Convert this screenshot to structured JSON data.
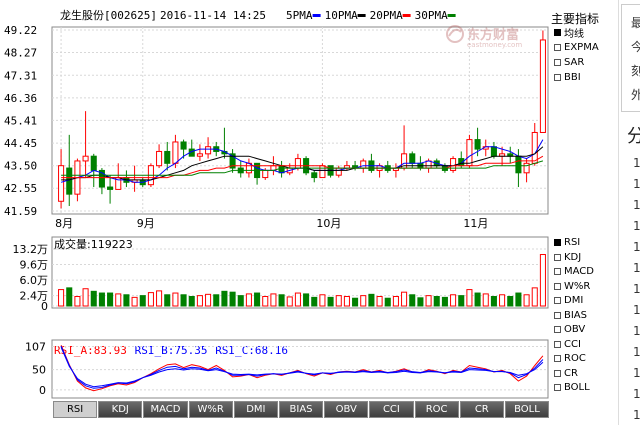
{
  "header": {
    "stock": "龙生股份[002625]",
    "datetime": "2016-11-14 14:25",
    "ma_legend": [
      {
        "label": "5PMA",
        "color": "#0000ff"
      },
      {
        "label": "10PMA",
        "color": "#000000"
      },
      {
        "label": "20PMA",
        "color": "#ff0000"
      },
      {
        "label": "30PMA",
        "color": "#008000"
      }
    ]
  },
  "logo": {
    "text": "东方财富",
    "sub": "eastmoney.com"
  },
  "side_main": {
    "title": "主要指标",
    "items": [
      {
        "label": "均线",
        "on": true
      },
      {
        "label": "EXPMA",
        "on": false
      },
      {
        "label": "SAR",
        "on": false
      },
      {
        "label": "BBI",
        "on": false
      }
    ]
  },
  "side_sub": {
    "items": [
      {
        "label": "RSI",
        "on": true
      },
      {
        "label": "KDJ",
        "on": false
      },
      {
        "label": "MACD",
        "on": false
      },
      {
        "label": "W%R",
        "on": false
      },
      {
        "label": "DMI",
        "on": false
      },
      {
        "label": "BIAS",
        "on": false
      },
      {
        "label": "OBV",
        "on": false
      },
      {
        "label": "CCI",
        "on": false
      },
      {
        "label": "ROC",
        "on": false
      },
      {
        "label": "CR",
        "on": false
      },
      {
        "label": "BOLL",
        "on": false
      }
    ]
  },
  "tabs": [
    "RSI",
    "KDJ",
    "MACD",
    "W%R",
    "DMI",
    "BIAS",
    "OBV",
    "CCI",
    "ROC",
    "CR",
    "BOLL"
  ],
  "right_panel": {
    "items": [
      "最",
      "今",
      "刻",
      "外"
    ],
    "heading": "分",
    "numbers": [
      "1",
      "1",
      "1",
      "1",
      "1",
      "1",
      "1",
      "1",
      "1",
      "1",
      "1",
      "1",
      "1"
    ]
  },
  "chart_data": [
    {
      "type": "candlestick",
      "y_ticks": [
        "49.22",
        "48.27",
        "47.31",
        "46.36",
        "45.41",
        "44.45",
        "43.50",
        "42.55",
        "41.59"
      ],
      "ylim": [
        41.59,
        49.22
      ],
      "x_labels": [
        {
          "label": "8月",
          "index": 0
        },
        {
          "label": "9月",
          "index": 10
        },
        {
          "label": "10月",
          "index": 32
        },
        {
          "label": "11月",
          "index": 50
        }
      ],
      "colors": {
        "up": "#ff0000",
        "down": "#008000"
      },
      "ohlc": [
        [
          42.0,
          44.2,
          41.7,
          43.5
        ],
        [
          43.4,
          44.8,
          41.8,
          42.3
        ],
        [
          42.3,
          43.8,
          42.0,
          43.7
        ],
        [
          43.7,
          45.8,
          43.0,
          43.9
        ],
        [
          43.9,
          44.0,
          42.6,
          43.3
        ],
        [
          43.3,
          43.4,
          42.3,
          42.6
        ],
        [
          42.6,
          43.1,
          41.9,
          42.5
        ],
        [
          42.5,
          43.6,
          42.5,
          43.0
        ],
        [
          43.0,
          43.3,
          42.6,
          42.8
        ],
        [
          42.8,
          43.5,
          42.4,
          42.9
        ],
        [
          42.9,
          43.0,
          42.6,
          42.7
        ],
        [
          42.7,
          43.6,
          42.6,
          43.5
        ],
        [
          43.5,
          44.4,
          43.4,
          44.1
        ],
        [
          44.1,
          44.5,
          43.3,
          43.6
        ],
        [
          43.6,
          44.8,
          43.4,
          44.5
        ],
        [
          44.5,
          44.6,
          43.8,
          44.2
        ],
        [
          44.2,
          44.6,
          43.9,
          43.9
        ],
        [
          43.9,
          44.4,
          43.7,
          44.0
        ],
        [
          44.0,
          44.7,
          43.8,
          44.3
        ],
        [
          44.3,
          44.5,
          43.9,
          44.1
        ],
        [
          44.1,
          45.1,
          43.8,
          44.0
        ],
        [
          44.0,
          44.2,
          43.2,
          43.4
        ],
        [
          43.4,
          43.7,
          43.0,
          43.2
        ],
        [
          43.2,
          43.8,
          43.0,
          43.6
        ],
        [
          43.6,
          43.6,
          42.7,
          43.0
        ],
        [
          43.0,
          43.4,
          42.9,
          43.3
        ],
        [
          43.3,
          43.9,
          43.1,
          43.5
        ],
        [
          43.5,
          43.7,
          43.0,
          43.2
        ],
        [
          43.2,
          43.6,
          43.1,
          43.4
        ],
        [
          43.4,
          44.0,
          43.3,
          43.8
        ],
        [
          43.8,
          43.9,
          43.1,
          43.2
        ],
        [
          43.2,
          43.3,
          42.8,
          43.0
        ],
        [
          43.0,
          43.6,
          43.0,
          43.5
        ],
        [
          43.5,
          43.5,
          43.0,
          43.1
        ],
        [
          43.1,
          43.5,
          43.0,
          43.4
        ],
        [
          43.4,
          43.7,
          43.3,
          43.5
        ],
        [
          43.5,
          43.7,
          43.3,
          43.4
        ],
        [
          43.4,
          43.8,
          43.2,
          43.7
        ],
        [
          43.7,
          44.0,
          43.2,
          43.3
        ],
        [
          43.3,
          43.6,
          43.0,
          43.5
        ],
        [
          43.5,
          43.7,
          43.2,
          43.3
        ],
        [
          43.3,
          43.6,
          43.0,
          43.4
        ],
        [
          43.4,
          45.2,
          43.3,
          44.0
        ],
        [
          44.0,
          44.1,
          43.4,
          43.6
        ],
        [
          43.6,
          43.9,
          43.3,
          43.4
        ],
        [
          43.4,
          43.8,
          43.2,
          43.7
        ],
        [
          43.7,
          43.8,
          43.4,
          43.5
        ],
        [
          43.5,
          43.6,
          43.2,
          43.3
        ],
        [
          43.3,
          43.9,
          43.2,
          43.8
        ],
        [
          43.8,
          44.1,
          43.4,
          43.5
        ],
        [
          43.5,
          44.8,
          43.4,
          44.6
        ],
        [
          44.6,
          45.1,
          43.9,
          44.2
        ],
        [
          44.2,
          44.6,
          43.9,
          44.3
        ],
        [
          44.3,
          44.5,
          43.8,
          43.9
        ],
        [
          43.9,
          44.3,
          43.5,
          44.0
        ],
        [
          44.0,
          44.3,
          43.6,
          43.9
        ],
        [
          43.9,
          44.2,
          42.6,
          43.2
        ],
        [
          43.2,
          43.8,
          42.8,
          43.6
        ],
        [
          43.6,
          45.3,
          43.5,
          44.9
        ],
        [
          44.9,
          49.2,
          46.3,
          48.8
        ]
      ],
      "ma": [
        {
          "name": "5PMA",
          "color": "#0000ff",
          "values": [
            42.8,
            42.9,
            43.0,
            43.1,
            43.3,
            43.2,
            43.0,
            42.9,
            42.9,
            42.8,
            42.8,
            42.9,
            43.1,
            43.4,
            43.6,
            43.9,
            44.1,
            44.2,
            44.2,
            44.2,
            44.1,
            43.9,
            43.7,
            43.6,
            43.4,
            43.3,
            43.3,
            43.2,
            43.3,
            43.4,
            43.4,
            43.3,
            43.3,
            43.3,
            43.3,
            43.4,
            43.4,
            43.5,
            43.5,
            43.5,
            43.4,
            43.4,
            43.6,
            43.6,
            43.6,
            43.7,
            43.6,
            43.5,
            43.5,
            43.6,
            43.9,
            44.1,
            44.3,
            44.3,
            44.2,
            44.1,
            43.9,
            43.8,
            44.0,
            44.6
          ]
        },
        {
          "name": "10PMA",
          "color": "#000000",
          "values": [
            42.9,
            42.9,
            43.0,
            43.0,
            43.1,
            43.1,
            43.0,
            43.0,
            42.9,
            42.9,
            42.9,
            42.9,
            43.0,
            43.1,
            43.2,
            43.3,
            43.5,
            43.6,
            43.7,
            43.8,
            43.9,
            43.9,
            43.9,
            43.9,
            43.8,
            43.7,
            43.6,
            43.5,
            43.4,
            43.4,
            43.4,
            43.3,
            43.3,
            43.3,
            43.3,
            43.3,
            43.4,
            43.4,
            43.4,
            43.4,
            43.4,
            43.4,
            43.5,
            43.5,
            43.5,
            43.5,
            43.5,
            43.5,
            43.5,
            43.6,
            43.6,
            43.7,
            43.8,
            43.9,
            43.9,
            43.9,
            43.9,
            43.9,
            44.0,
            44.3
          ]
        },
        {
          "name": "20PMA",
          "color": "#ff0000",
          "values": [
            43.0,
            43.0,
            43.0,
            43.0,
            43.0,
            43.0,
            43.0,
            43.0,
            43.0,
            43.0,
            43.0,
            43.0,
            43.0,
            43.0,
            43.1,
            43.1,
            43.2,
            43.3,
            43.3,
            43.4,
            43.4,
            43.5,
            43.5,
            43.5,
            43.5,
            43.5,
            43.5,
            43.5,
            43.5,
            43.5,
            43.5,
            43.5,
            43.5,
            43.4,
            43.4,
            43.4,
            43.4,
            43.4,
            43.4,
            43.4,
            43.4,
            43.4,
            43.4,
            43.4,
            43.4,
            43.4,
            43.4,
            43.4,
            43.5,
            43.5,
            43.5,
            43.5,
            43.6,
            43.6,
            43.6,
            43.6,
            43.7,
            43.7,
            43.7,
            43.9
          ]
        },
        {
          "name": "30PMA",
          "color": "#008000",
          "values": [
            43.1,
            43.1,
            43.1,
            43.1,
            43.1,
            43.1,
            43.1,
            43.1,
            43.1,
            43.1,
            43.1,
            43.1,
            43.1,
            43.1,
            43.1,
            43.1,
            43.1,
            43.2,
            43.2,
            43.2,
            43.2,
            43.3,
            43.3,
            43.3,
            43.3,
            43.3,
            43.3,
            43.4,
            43.4,
            43.4,
            43.4,
            43.4,
            43.4,
            43.4,
            43.4,
            43.4,
            43.4,
            43.4,
            43.4,
            43.4,
            43.4,
            43.4,
            43.4,
            43.4,
            43.4,
            43.4,
            43.4,
            43.4,
            43.4,
            43.4,
            43.4,
            43.4,
            43.4,
            43.5,
            43.5,
            43.5,
            43.5,
            43.5,
            43.6,
            43.7
          ]
        }
      ]
    },
    {
      "type": "bar",
      "title_label": "成交量:",
      "title_value": "119223",
      "y_ticks": [
        "13.2万",
        "9.6万",
        "6.0万",
        "2.4万",
        "0"
      ],
      "y_tick_values": [
        132000,
        96000,
        60000,
        24000,
        0
      ],
      "ylim": [
        0,
        132000
      ],
      "values": [
        38000,
        42000,
        22000,
        40000,
        34000,
        30000,
        30000,
        28000,
        26000,
        20000,
        24000,
        31000,
        35000,
        26000,
        30000,
        26000,
        22000,
        24000,
        27000,
        26000,
        34000,
        32000,
        24000,
        28000,
        30000,
        22000,
        28000,
        26000,
        21000,
        30000,
        28000,
        20000,
        26000,
        20000,
        24000,
        22000,
        18000,
        24000,
        27000,
        22000,
        18000,
        22000,
        32000,
        26000,
        19000,
        24000,
        22000,
        20000,
        26000,
        24000,
        38000,
        30000,
        28000,
        22000,
        26000,
        22000,
        30000,
        26000,
        42000,
        119223
      ]
    },
    {
      "type": "line",
      "series_labels": [
        {
          "text": "RSI_A:83.93",
          "color": "#ff0000"
        },
        {
          "text": "RSI_B:75.35",
          "color": "#0000ff"
        },
        {
          "text": "RSI_C:68.16",
          "color": "#0000ff"
        }
      ],
      "y_ticks": [
        "107",
        "50",
        "0"
      ],
      "y_tick_values": [
        107,
        50,
        0
      ],
      "ylim": [
        -15,
        118
      ],
      "series": [
        {
          "name": "RSI_A",
          "color": "#ff0000",
          "values": [
            110,
            62,
            22,
            5,
            -2,
            3,
            10,
            15,
            12,
            18,
            30,
            40,
            52,
            62,
            64,
            55,
            62,
            58,
            50,
            60,
            48,
            32,
            34,
            38,
            30,
            36,
            40,
            36,
            42,
            48,
            40,
            34,
            42,
            38,
            44,
            46,
            44,
            50,
            44,
            48,
            42,
            46,
            52,
            44,
            42,
            50,
            46,
            40,
            48,
            44,
            60,
            56,
            52,
            44,
            48,
            40,
            22,
            34,
            60,
            84
          ]
        },
        {
          "name": "RSI_B",
          "color": "#0000ff",
          "values": [
            108,
            60,
            25,
            10,
            4,
            6,
            12,
            17,
            15,
            20,
            30,
            38,
            48,
            56,
            58,
            52,
            56,
            54,
            48,
            54,
            46,
            36,
            36,
            38,
            34,
            38,
            40,
            38,
            42,
            46,
            41,
            37,
            42,
            40,
            44,
            45,
            44,
            47,
            44,
            46,
            43,
            45,
            49,
            45,
            43,
            47,
            45,
            42,
            46,
            44,
            54,
            52,
            50,
            45,
            46,
            42,
            30,
            38,
            54,
            75
          ]
        },
        {
          "name": "RSI_C",
          "color": "#0000ff",
          "values": [
            105,
            58,
            28,
            14,
            8,
            10,
            14,
            18,
            17,
            22,
            30,
            36,
            44,
            50,
            52,
            49,
            52,
            51,
            47,
            50,
            45,
            39,
            38,
            39,
            37,
            39,
            40,
            39,
            41,
            44,
            41,
            39,
            42,
            41,
            43,
            44,
            43,
            45,
            43,
            44,
            42,
            43,
            46,
            43,
            42,
            45,
            44,
            42,
            44,
            43,
            50,
            49,
            48,
            45,
            45,
            43,
            36,
            40,
            50,
            68
          ]
        }
      ]
    }
  ]
}
